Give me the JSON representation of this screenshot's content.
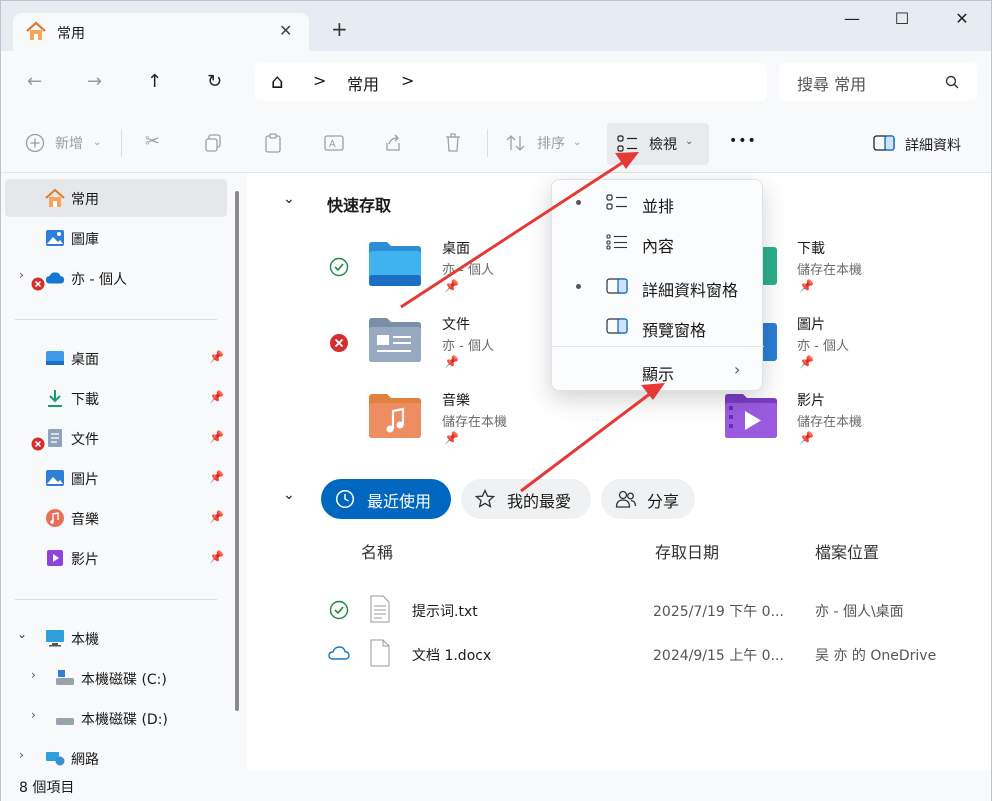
{
  "tab": {
    "title": "常用",
    "close": "✕",
    "new_tab": "+"
  },
  "window_controls": {
    "minimize": "—",
    "maximize": "☐",
    "close": "✕"
  },
  "nav": {
    "back": "←",
    "forward": "→",
    "up": "↑",
    "refresh": "↻"
  },
  "address": {
    "home": "⌂",
    "sep1": ">",
    "crumb": "常用",
    "sep2": ">"
  },
  "search": {
    "placeholder": "搜尋 常用"
  },
  "toolbar": {
    "new_label": "新增",
    "sort_label": "排序",
    "view_label": "檢視",
    "more_label": "•••",
    "details_label": "詳細資料"
  },
  "sidebar": {
    "home": "常用",
    "gallery": "圖庫",
    "onedrive": "亦 - 個人",
    "desktop": "桌面",
    "downloads": "下載",
    "documents": "文件",
    "pictures": "圖片",
    "music": "音樂",
    "videos": "影片",
    "this_pc": "本機",
    "drive_c": "本機磁碟 (C:)",
    "drive_d": "本機磁碟 (D:)",
    "network": "網路"
  },
  "quick_access": {
    "title": "快速存取",
    "items": [
      {
        "name": "桌面",
        "sub": "亦 - 個人"
      },
      {
        "name": "文件",
        "sub": "亦 - 個人"
      },
      {
        "name": "音樂",
        "sub": "儲存在本機"
      },
      {
        "name": "下載",
        "sub": "儲存在本機"
      },
      {
        "name": "圖片",
        "sub": "亦 - 個人"
      },
      {
        "name": "影片",
        "sub": "儲存在本機"
      }
    ]
  },
  "recent_tabs": {
    "recent": "最近使用",
    "favorites": "我的最愛",
    "shared": "分享"
  },
  "columns": {
    "name": "名稱",
    "date": "存取日期",
    "location": "檔案位置"
  },
  "files": [
    {
      "name": "提示词.txt",
      "date": "2025/7/19 下午 0...",
      "location": "亦 - 個人\\桌面"
    },
    {
      "name": "文档 1.docx",
      "date": "2024/9/15 上午 0...",
      "location": "吴 亦 的 OneDrive"
    }
  ],
  "view_menu": {
    "tiles": "並排",
    "content": "內容",
    "details_pane": "詳細資料窗格",
    "preview_pane": "預覽窗格",
    "show": "顯示"
  },
  "status": {
    "items": "8 個項目"
  },
  "colors": {
    "accent": "#0067c0",
    "annotation_arrow": "#e53935"
  }
}
